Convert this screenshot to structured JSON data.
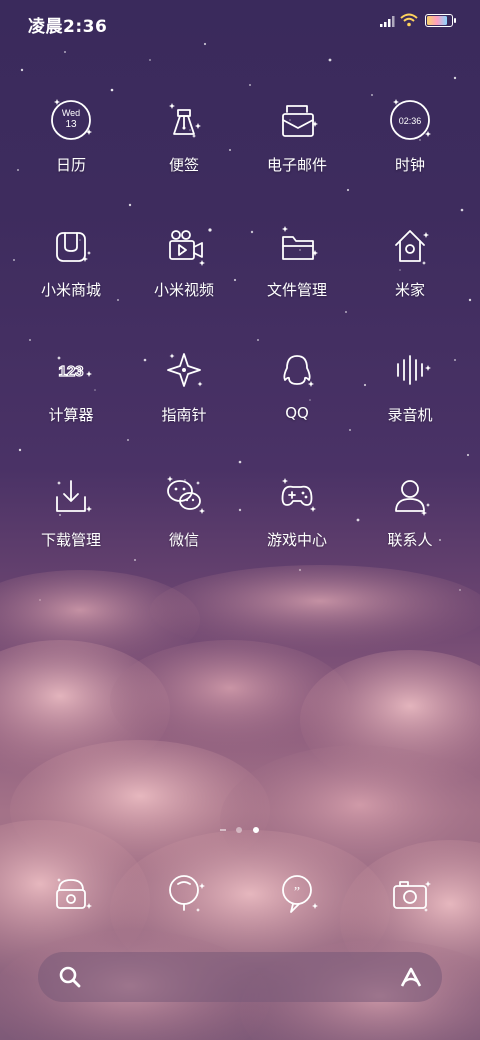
{
  "status_bar": {
    "time": "凌晨2:36",
    "battery_level": 0.9
  },
  "apps": [
    {
      "label": "日历",
      "icon": "calendar-icon",
      "day": "Wed",
      "date": "13"
    },
    {
      "label": "便签",
      "icon": "notes-icon"
    },
    {
      "label": "电子邮件",
      "icon": "email-icon"
    },
    {
      "label": "时钟",
      "icon": "clock-icon",
      "time": "02:36"
    },
    {
      "label": "小米商城",
      "icon": "mi-store-icon"
    },
    {
      "label": "小米视频",
      "icon": "video-icon"
    },
    {
      "label": "文件管理",
      "icon": "folder-icon"
    },
    {
      "label": "米家",
      "icon": "mi-home-icon"
    },
    {
      "label": "计算器",
      "icon": "calculator-icon",
      "digits": "123"
    },
    {
      "label": "指南针",
      "icon": "compass-icon"
    },
    {
      "label": "QQ",
      "icon": "qq-icon"
    },
    {
      "label": "录音机",
      "icon": "recorder-icon"
    },
    {
      "label": "下载管理",
      "icon": "download-icon"
    },
    {
      "label": "微信",
      "icon": "wechat-icon"
    },
    {
      "label": "游戏中心",
      "icon": "gamepad-icon"
    },
    {
      "label": "联系人",
      "icon": "contacts-icon"
    }
  ],
  "page_indicator": {
    "pages": 3,
    "active": 2
  },
  "dock": [
    {
      "icon": "phone-icon"
    },
    {
      "icon": "browser-icon"
    },
    {
      "icon": "messages-icon"
    },
    {
      "icon": "camera-icon"
    }
  ],
  "search_bar": {
    "left_icon": "search-icon",
    "right_icon": "assistant-icon"
  }
}
